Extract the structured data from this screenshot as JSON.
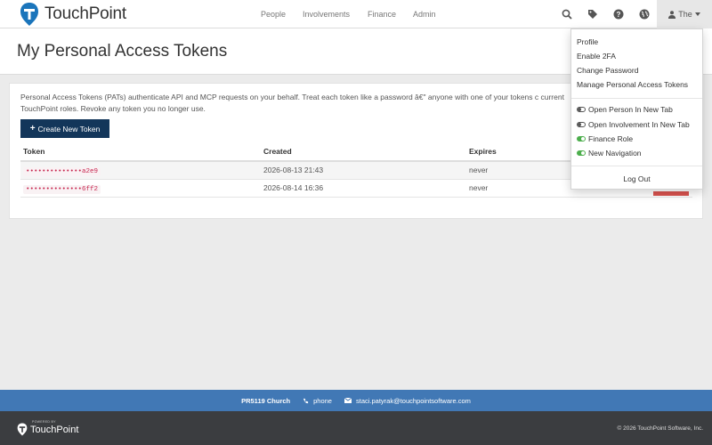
{
  "brand": {
    "name": "TouchPoint",
    "accent": "#1b75bb",
    "footer_blue": "#4178b5",
    "primary_button": "#13365a"
  },
  "nav": {
    "items": [
      "People",
      "Involvements",
      "Finance",
      "Admin"
    ]
  },
  "topbar": {
    "icons": [
      "search-icon",
      "tag-icon",
      "help-icon",
      "globe-icon"
    ],
    "user_label": "The"
  },
  "page": {
    "title": "My Personal Access Tokens"
  },
  "panel": {
    "description": "Personal Access Tokens (PATs) authenticate API and MCP requests on your behalf. Treat each token like a password â€\" anyone with one of your tokens c current TouchPoint roles. Revoke any token you no longer use.",
    "create_label": "Create New Token",
    "columns": [
      "Token",
      "Created",
      "Expires"
    ],
    "rows": [
      {
        "token": "••••••••••••••a2e9",
        "created": "2026-08-13 21:43",
        "expires": "never"
      },
      {
        "token": "••••••••••••••6ff2",
        "created": "2026-08-14 16:36",
        "expires": "never"
      }
    ]
  },
  "dropdown": {
    "items": [
      "Profile",
      "Enable 2FA",
      "Change Password",
      "Manage Personal Access Tokens"
    ],
    "toggles": [
      {
        "label": "Open Person In New Tab",
        "state": "off"
      },
      {
        "label": "Open Involvement In New Tab",
        "state": "off"
      },
      {
        "label": "Finance Role",
        "state": "on"
      },
      {
        "label": "New Navigation",
        "state": "on"
      }
    ],
    "logout": "Log Out"
  },
  "footer": {
    "church": "PR5119 Church",
    "phone": "phone",
    "email": "staci.patyrak@touchpointsoftware.com",
    "powered_by": "POWERED BY",
    "logo_text": "TouchPoint",
    "copyright": "© 2026 TouchPoint Software, Inc."
  }
}
